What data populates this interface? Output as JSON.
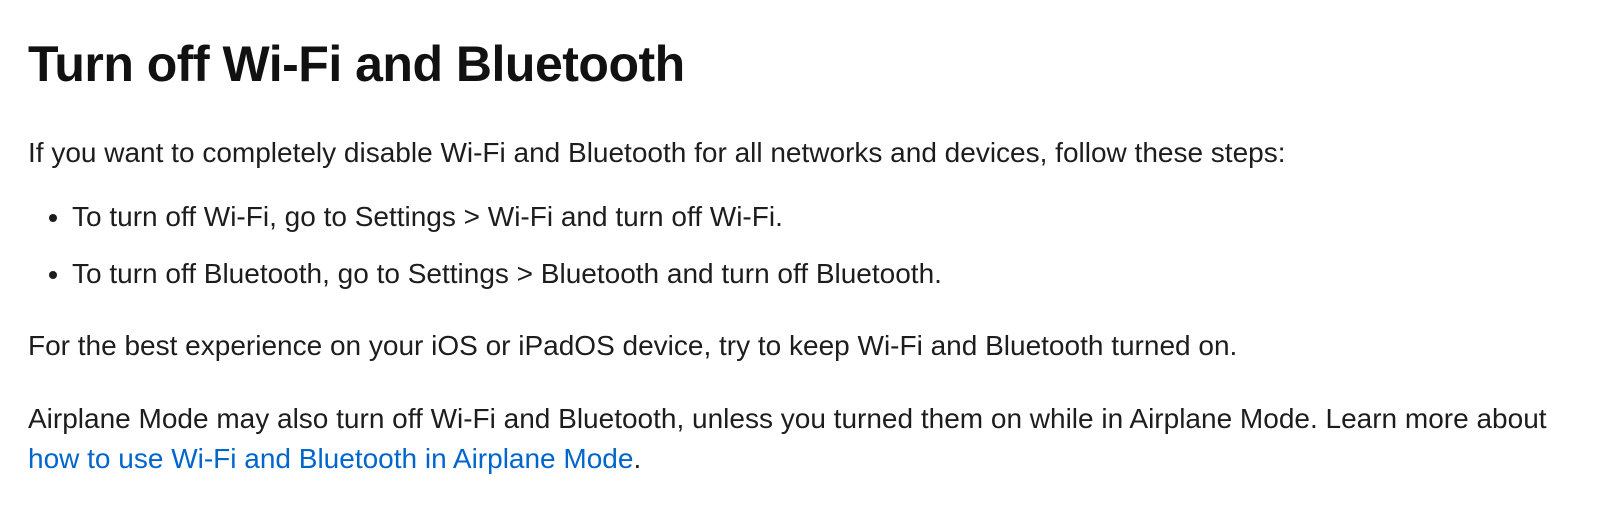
{
  "heading": "Turn off Wi-Fi and Bluetooth",
  "intro": "If you want to completely disable Wi-Fi and Bluetooth for all networks and devices, follow these steps:",
  "steps": [
    "To turn off Wi-Fi, go to Settings > Wi-Fi and turn off Wi-Fi.",
    "To turn off Bluetooth, go to Settings > Bluetooth and turn off Bluetooth."
  ],
  "recommendation": "For the best experience on your iOS or iPadOS device, try to keep Wi-Fi and Bluetooth turned on.",
  "airplane": {
    "prefix": "Airplane Mode may also turn off Wi-Fi and Bluetooth, unless you turned them on while in Airplane Mode. Learn more about ",
    "link_text": "how to use Wi-Fi and Bluetooth in Airplane Mode",
    "suffix": "."
  }
}
